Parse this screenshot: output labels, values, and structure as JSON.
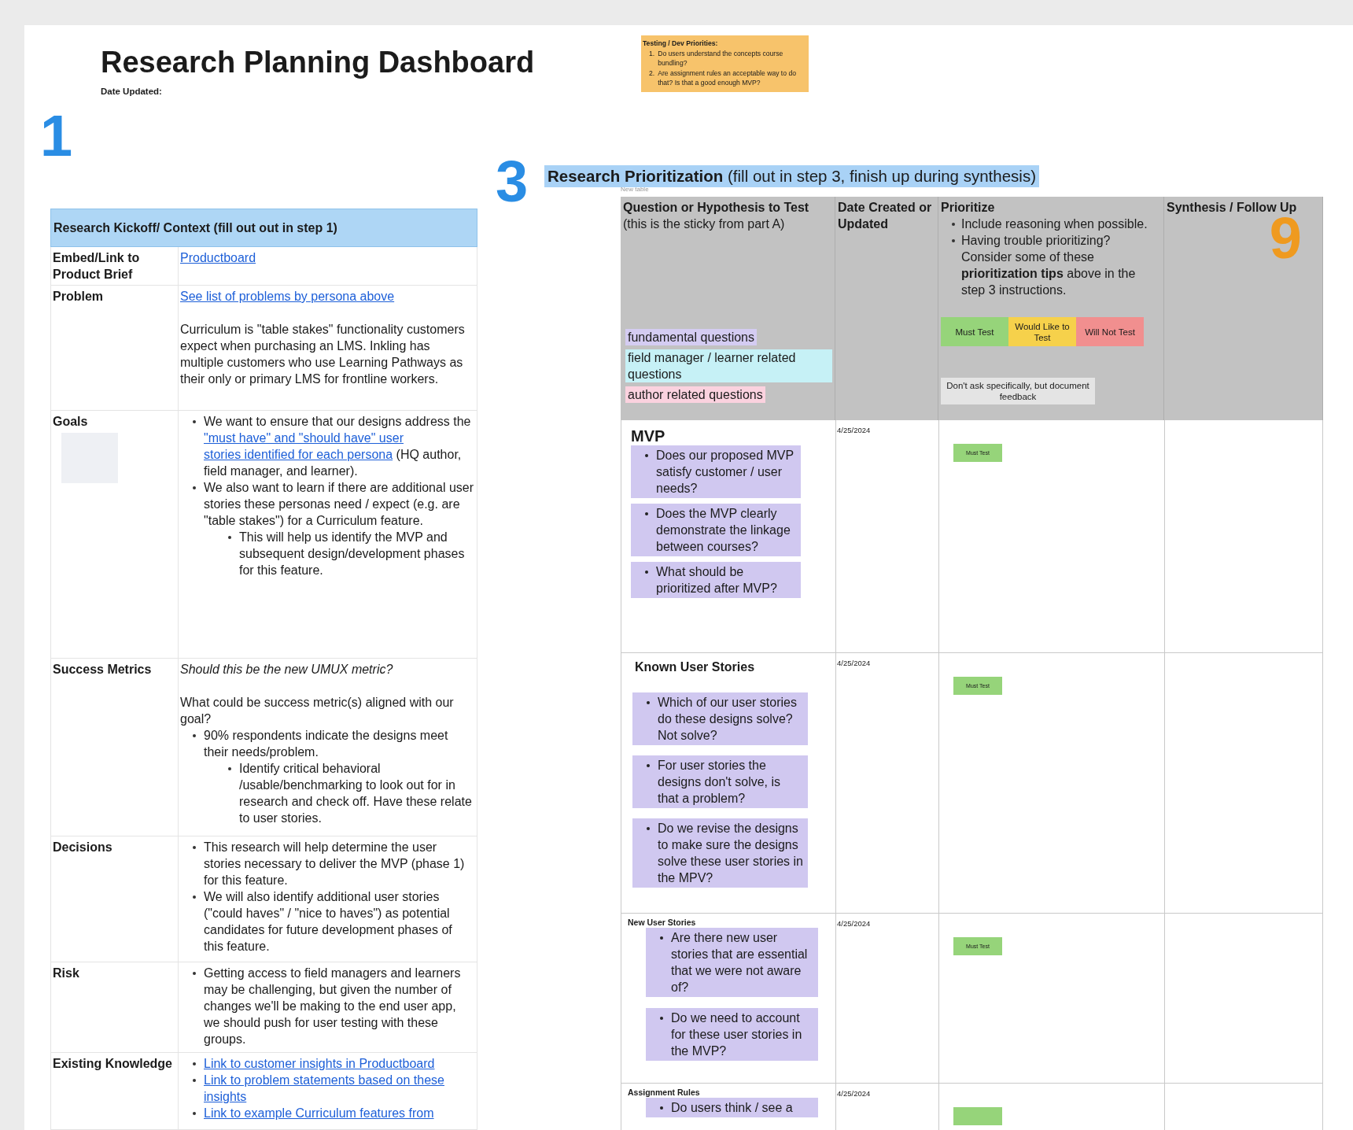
{
  "header": {
    "title": "Research Planning Dashboard",
    "date_label": "Date Updated:"
  },
  "sticky": {
    "title": "Testing / Dev Priorities:",
    "items": [
      {
        "number": "1.",
        "text": "Do users understand the concepts course bundling?"
      },
      {
        "number": "2.",
        "text": "Are assignment rules an acceptable way to do that? Is that a good enough MVP?"
      }
    ]
  },
  "kickoff": {
    "step": "1",
    "title": "Research Kickoff/ Context (fill out out in step 1)",
    "rows": [
      {
        "label": "Embed/Link to Product Brief",
        "blocks": [
          {
            "kind": "link",
            "text": "Productboard"
          }
        ]
      },
      {
        "label": "Problem",
        "blocks": [
          {
            "kind": "link",
            "text": "See list of problems by persona above"
          },
          {
            "kind": "paragraph",
            "text": "Curriculum is \"table stakes\" functionality customers expect when purchasing an LMS. Inkling has multiple customers who use Learning Pathways as their only or primary LMS for frontline workers."
          }
        ]
      },
      {
        "label": "Goals",
        "has_thumbnail": true,
        "blocks": [
          {
            "kind": "bullets",
            "items": [
              {
                "parts": [
                  {
                    "kind": "plain",
                    "text": "We want to ensure that our designs address the "
                  },
                  {
                    "kind": "link",
                    "text": "\"must have\" and \"should have\" user"
                  },
                  {
                    "kind": "link",
                    "text": "stories identified for each persona"
                  },
                  {
                    "kind": "plain",
                    "text": " (HQ author, field manager, and learner)."
                  }
                ]
              },
              {
                "parts": [
                  {
                    "kind": "plain",
                    "text": "We also want to learn if there are additional user stories these personas need / expect (e.g. are \"table stakes\") for a Curriculum feature."
                  }
                ],
                "children": [
                  {
                    "parts": [
                      {
                        "kind": "plain",
                        "text": "This will help us identify the MVP and subsequent design/development phases for this feature."
                      }
                    ]
                  }
                ]
              }
            ]
          }
        ]
      },
      {
        "label": "Success Metrics",
        "blocks": [
          {
            "kind": "italic",
            "text": "Should this be the new UMUX metric?"
          },
          {
            "kind": "paragraph",
            "text": "What could be success metric(s) aligned with our goal?"
          },
          {
            "kind": "bullets",
            "items": [
              {
                "parts": [
                  {
                    "kind": "plain",
                    "text": "90% respondents indicate the designs meet their needs/problem."
                  }
                ],
                "children": [
                  {
                    "parts": [
                      {
                        "kind": "plain",
                        "text": "Identify critical behavioral /usable/benchmarking  to look out for in research and check off. Have these relate to user stories."
                      }
                    ]
                  }
                ]
              }
            ]
          }
        ]
      },
      {
        "label": "Decisions",
        "blocks": [
          {
            "kind": "bullets",
            "items": [
              {
                "parts": [
                  {
                    "kind": "plain",
                    "text": "This research will help determine the user stories necessary to deliver the MVP (phase 1) for this feature."
                  }
                ]
              },
              {
                "parts": [
                  {
                    "kind": "plain",
                    "text": "We will also identify additional user stories (\"could haves\" / \"nice to haves\") as potential candidates for future development phases of this feature."
                  }
                ]
              }
            ]
          }
        ]
      },
      {
        "label": "Risk",
        "blocks": [
          {
            "kind": "bullets",
            "items": [
              {
                "parts": [
                  {
                    "kind": "plain",
                    "text": "Getting access to field managers and learners may be challenging, but given the number of changes we'll be making to the end user app, we should push for user testing with these groups."
                  }
                ]
              }
            ]
          }
        ]
      },
      {
        "label": "Existing Knowledge",
        "blocks": [
          {
            "kind": "bullets",
            "items": [
              {
                "parts": [
                  {
                    "kind": "link",
                    "text": "Link to customer insights in Productboard"
                  }
                ]
              },
              {
                "parts": [
                  {
                    "kind": "link",
                    "text": "Link to problem statements based on these insights"
                  }
                ]
              },
              {
                "parts": [
                  {
                    "kind": "link",
                    "text": "Link to example Curriculum features from"
                  }
                ]
              }
            ]
          }
        ]
      }
    ]
  },
  "prioritization": {
    "step": "3",
    "title": "Research Prioritization",
    "subtitle": "(fill out in step 3, finish up during synthesis)",
    "table_label": "New table",
    "columns": [
      {
        "kind": "question",
        "title": "Question or Hypothesis to Test",
        "note": "(this is the sticky from part A)",
        "tags": [
          {
            "text": "fundamental questions",
            "color": "#d4ccf2"
          },
          {
            "text": "field manager / learner related questions",
            "color": "#c6f1f6"
          },
          {
            "text": "author related questions",
            "color": "#fbd2df"
          }
        ]
      },
      {
        "kind": "date",
        "title": "Date Created or Updated"
      },
      {
        "kind": "priority",
        "title": "Prioritize",
        "bullets": [
          "Include reasoning when possible.",
          "Having trouble prioritizing? Consider some of these **prioritization tips** above in the step 3 instructions."
        ],
        "legend": [
          {
            "label": "Must Test",
            "color": "#96d47a"
          },
          {
            "label": "Would Like to Test",
            "color": "#f6d14b"
          },
          {
            "label": "Will Not Test",
            "color": "#f18f8f"
          }
        ],
        "note": {
          "text": "Don't ask specifically, but document feedback",
          "color": "#e4e4e4"
        }
      },
      {
        "kind": "synthesis",
        "title": "Synthesis / Follow Up",
        "marker": "9"
      }
    ],
    "rows": [
      {
        "heading": "MVP",
        "kind": "large",
        "questions": [
          "Does our proposed MVP satisfy customer / user needs?",
          "Does the MVP clearly demonstrate the linkage between courses?",
          "What should be prioritized after MVP?"
        ],
        "date": "4/25/2024",
        "priority": {
          "label": "Must Test",
          "color": "#96d47a"
        }
      },
      {
        "heading": "Known User Stories",
        "kind": "medium",
        "questions": [
          "Which of our user stories do these designs solve? Not solve?",
          "For user stories the designs don't solve, is that a problem?",
          "Do we revise the designs to make sure the designs solve these user stories in the MPV?"
        ],
        "date": "4/25/2024",
        "priority": {
          "label": "Must Test",
          "color": "#96d47a"
        }
      },
      {
        "heading": "New User Stories",
        "kind": "small",
        "questions": [
          "Are there new user stories that are essential that we were not aware of?",
          "Do we need to account for these user stories in the MVP?"
        ],
        "date": "4/25/2024",
        "priority": {
          "label": "Must Test",
          "color": "#96d47a"
        }
      },
      {
        "heading": "Assignment Rules",
        "kind": "small",
        "questions": [
          "Do users think / see a"
        ],
        "date": "4/25/2024",
        "priority": {
          "color": "#96d47a"
        }
      }
    ]
  }
}
